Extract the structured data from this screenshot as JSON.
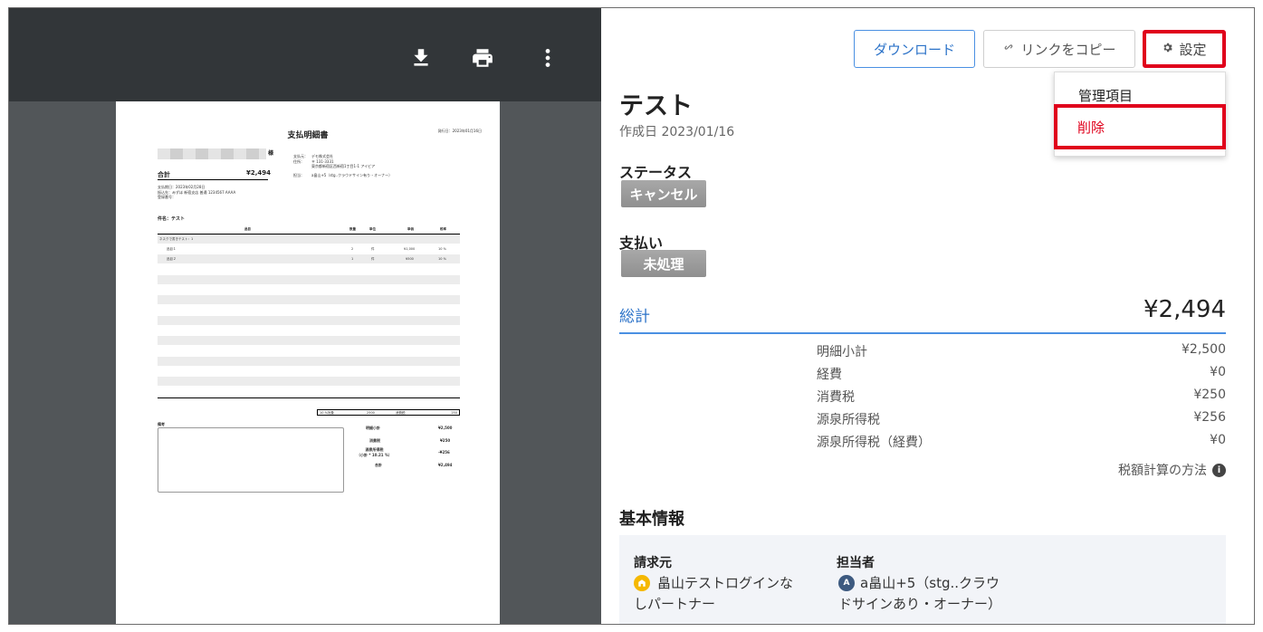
{
  "viewer": {
    "toolbar_icons": [
      "download-icon",
      "print-icon",
      "more-vert-icon"
    ],
    "pdf": {
      "title": "支払明細書",
      "issue_date": "発行日：2023年01月16日",
      "recipient_suffix": "様",
      "total_label": "合計",
      "total_value": "¥2,494",
      "payer_lines": [
        "支払元：　デモ株式会社",
        "住所：　　〒 131-3331",
        "　　　　　東京都新宿区西新宿1丁目1-1 アイビア",
        "担当：　　a畠山+5（stg..クラウドサイン有り・オーナー）"
      ],
      "meta_lines": [
        "支払期日：2023年02月28日",
        "振込先：みずほ 新宿支店 普通 1234567 AAAA",
        "登録番号："
      ],
      "subject": "件名：テスト",
      "columns": [
        "品目",
        "数量",
        "単位",
        "単価",
        "税率"
      ],
      "group_label": "ネスクで書きテスト：1",
      "rows": [
        {
          "item": "品目１",
          "qty": "2",
          "unit": "件",
          "price": "¥1,000",
          "tax": "10 %"
        },
        {
          "item": "品目２",
          "qty": "1",
          "unit": "件",
          "price": "¥500",
          "tax": "10 %"
        }
      ],
      "tax_summary": {
        "label": "10 %対象",
        "amount": "2500",
        "tax_label": "消費税",
        "tax": "250"
      },
      "remarks_label": "備考",
      "totals": [
        {
          "label": "明細小計",
          "value": "¥2,500"
        },
        {
          "label": "消費税",
          "value": "¥250"
        },
        {
          "label": "源泉所得税\n（小計 * 10.21 %）",
          "value": "-¥256"
        },
        {
          "label": "合計",
          "value": "¥2,494"
        }
      ]
    }
  },
  "panel": {
    "buttons": {
      "download": "ダウンロード",
      "copy_link": "リンクをコピー",
      "settings": "設定"
    },
    "dropdown": {
      "manage": "管理項目",
      "delete": "削除"
    },
    "title": "テスト",
    "created": "作成日 2023/01/16",
    "status_label": "ステータス",
    "status_value": "キャンセル",
    "payment_label": "支払い",
    "payment_value": "未処理",
    "total_label": "総計",
    "total_value": "¥2,494",
    "breakdown": [
      {
        "label": "明細小計",
        "value": "¥2,500"
      },
      {
        "label": "経費",
        "value": "¥0"
      },
      {
        "label": "消費税",
        "value": "¥250"
      },
      {
        "label": "源泉所得税",
        "value": "¥256"
      },
      {
        "label": "源泉所得税（経費）",
        "value": "¥0"
      }
    ],
    "tax_method": "税額計算の方法",
    "basic_title": "基本情報",
    "basic": {
      "biller_label": "請求元",
      "biller_name_l1": "畠山テストログインな",
      "biller_name_l2": "しパートナー",
      "owner_label": "担当者",
      "owner_avatar": "A",
      "owner_name_l1": "a畠山+5（stg..クラウ",
      "owner_name_l2": "ドサインあり・オーナー）"
    },
    "colors": {
      "accent": "#2b72c8",
      "highlight": "#e0001b",
      "badge": "#9a9a9a",
      "biller_avatar": "#f5b800",
      "owner_avatar": "#3d5a80"
    }
  }
}
